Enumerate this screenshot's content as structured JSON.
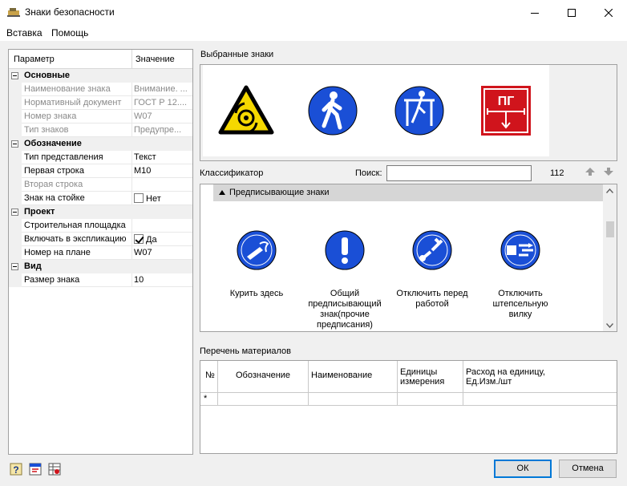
{
  "window": {
    "title": "Знаки безопасности"
  },
  "menu": {
    "items": [
      "Вставка",
      "Помощь"
    ]
  },
  "props": {
    "col_param": "Параметр",
    "col_value": "Значение",
    "cat_basic": "Основные",
    "name_label": "Наименование знака",
    "name_value": "Внимание. ...",
    "doc_label": "Нормативный документ",
    "doc_value": "ГОСТ Р 12....",
    "num_label": "Номер знака",
    "num_value": "W07",
    "type_label": "Тип знаков",
    "type_value": "Предупре...",
    "cat_desig": "Обозначение",
    "repr_label": "Тип представления",
    "repr_value": "Текст",
    "line1_label": "Первая строка",
    "line1_value": "М10",
    "line2_label": "Вторая строка",
    "line2_value": "",
    "stand_label": "Знак на стойке",
    "stand_value": "Нет",
    "cat_project": "Проект",
    "site_label": "Строительная площадка",
    "site_value": "",
    "expl_label": "Включать в экспликацию",
    "expl_value": "Да",
    "plan_label": "Номер на плане",
    "plan_value": "W07",
    "cat_view": "Вид",
    "size_label": "Размер знака",
    "size_value": "10"
  },
  "selected": {
    "label": "Выбранные знаки"
  },
  "classifier": {
    "label": "Классификатор",
    "search_label": "Поиск:",
    "search_value": "",
    "count": "112",
    "group": "Предписывающие знаки",
    "items": [
      {
        "caption": "Курить здесь",
        "icon": "smoking-area-icon"
      },
      {
        "caption": "Общий предписывающий знак(прочие предписания)",
        "icon": "exclamation-icon"
      },
      {
        "caption": "Отключить перед работой",
        "icon": "switch-off-icon"
      },
      {
        "caption": "Отключить штепсельную вилку",
        "icon": "unplug-icon"
      }
    ]
  },
  "materials": {
    "label": "Перечень материалов",
    "columns": [
      "№",
      "Обозначение",
      "Наименование",
      "Единицы измерения",
      "Расход на единицу, Ед.Изм./шт"
    ],
    "new_row_marker": "*"
  },
  "buttons": {
    "ok": "ОК",
    "cancel": "Отмена"
  },
  "colors": {
    "sign_blue": "#1a4fd6",
    "sign_red": "#d0141c",
    "sign_yellow": "#f5d800"
  }
}
